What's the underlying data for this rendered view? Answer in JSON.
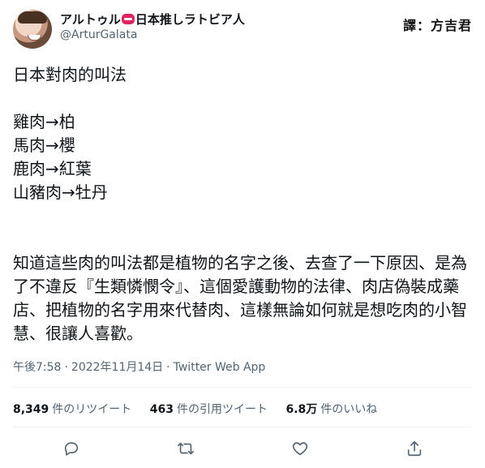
{
  "author": {
    "display_name_part1": "アルトゥル",
    "display_name_part2": "日本推しラトビア人",
    "username": "@ArturGalata"
  },
  "watermark": "譯：方吉君",
  "tweet": {
    "text": "日本對肉的叫法\n\n雞肉→柏\n馬肉→櫻\n鹿肉→紅葉\n山豬肉→牡丹\n\n\n知道這些肉的叫法都是植物的名字之後、去查了一下原因、是為了不違反『生類憐憫令』、這個愛護動物的法律、肉店偽裝成藥店、把植物的名字用來代替肉、這樣無論如何就是想吃肉的小智慧、很讓人喜歡。"
  },
  "meta": {
    "time": "午後7:58",
    "date": "2022年11月14日",
    "source": "Twitter Web App",
    "separator": "·"
  },
  "stats": {
    "retweets": "8,349",
    "retweets_label": "件のリツイート",
    "quotes": "463",
    "quotes_label": "件の引用ツイート",
    "likes": "6.8万",
    "likes_label": "件のいいね"
  },
  "icons": {
    "reply": "reply-icon",
    "retweet": "retweet-icon",
    "like": "heart-icon",
    "share": "share-icon",
    "badge": "red-badge-icon"
  },
  "colors": {
    "text": "#0f1419",
    "secondary": "#536471",
    "divider": "#eff3f4",
    "badge": "#e0245e"
  }
}
